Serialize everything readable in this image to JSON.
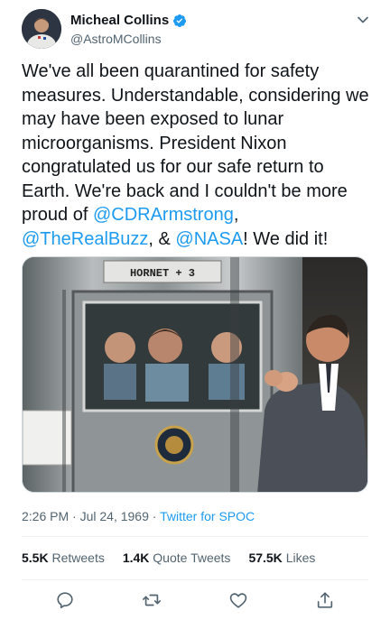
{
  "author": {
    "display_name": "Micheal Collins",
    "handle": "@AstroMCollins",
    "verified": true
  },
  "tweet": {
    "text_1": "We've all been quarantined for safety measures. Understandable, considering we may have been exposed to lunar microorganisms. President Nixon congratulated us for our safe return to Earth. We're back and I couldn't be more proud of ",
    "mention_1": "@CDRArmstrong",
    "text_2": ",",
    "mention_2": "@TheRealBuzz",
    "text_3": ", & ",
    "mention_3": "@NASA",
    "text_4": "! We did it!"
  },
  "media": {
    "sign_text": "HORNET + 3"
  },
  "meta": {
    "time": "2:26 PM",
    "separator_1": " · ",
    "date": "Jul 24, 1969",
    "separator_2": " · ",
    "source": "Twitter for SPOC"
  },
  "stats": {
    "retweets_count": "5.5K",
    "retweets_label": "Retweets",
    "quotes_count": "1.4K",
    "quotes_label": "Quote Tweets",
    "likes_count": "57.5K",
    "likes_label": "Likes"
  },
  "icons": {
    "reply": "reply-icon",
    "retweet": "retweet-icon",
    "like": "heart-icon",
    "share": "share-icon",
    "verified": "verified-badge-icon",
    "more": "chevron-down-icon"
  },
  "colors": {
    "link": "#1d9bf0",
    "secondary_text": "#536471",
    "primary_text": "#0f1419"
  }
}
